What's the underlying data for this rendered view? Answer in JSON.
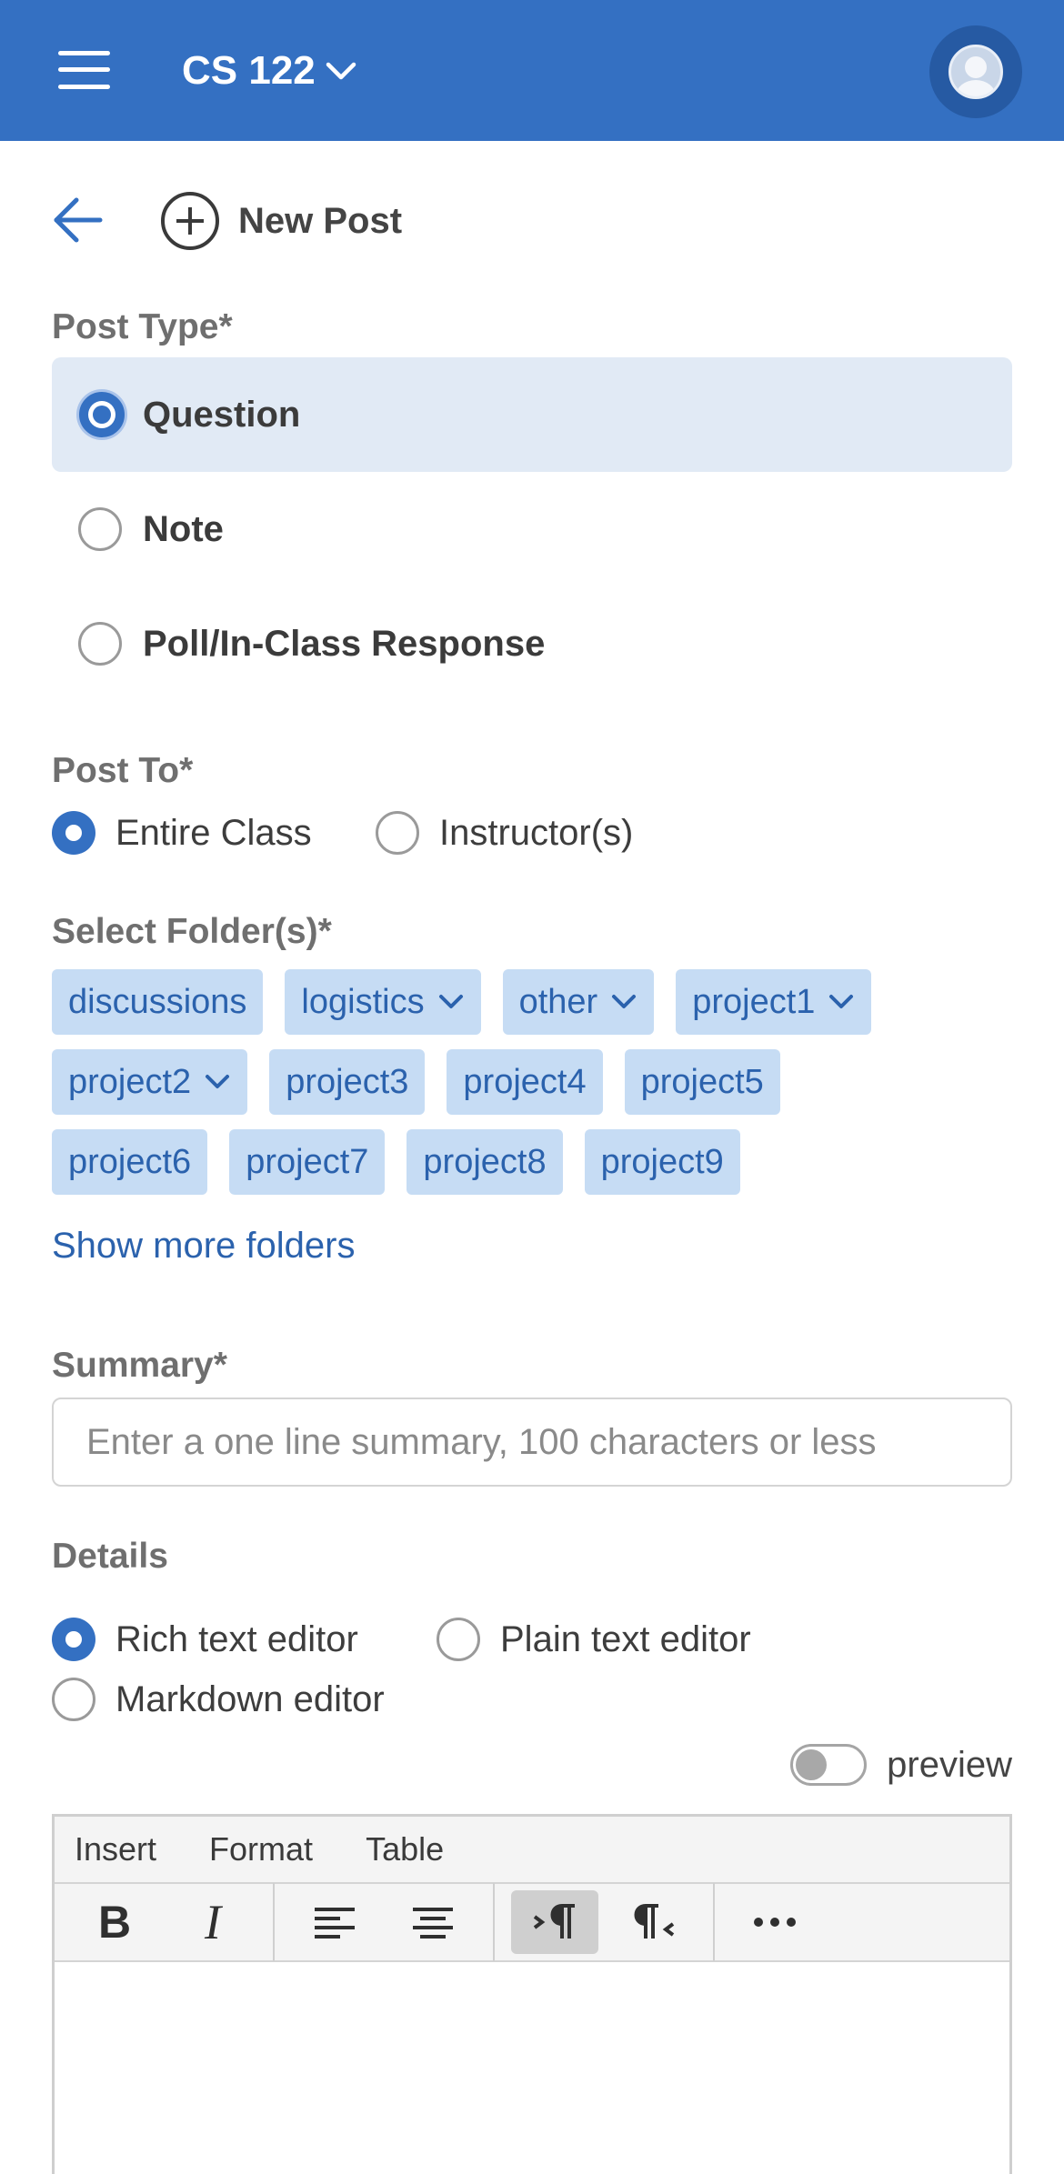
{
  "topbar": {
    "course_name": "CS 122",
    "menu_icon": "hamburger-icon",
    "course_dropdown_icon": "chevron-down-icon",
    "avatar_icon": "user-avatar-icon",
    "color": "#3470c2"
  },
  "header": {
    "back_icon": "arrow-left-icon",
    "new_post_icon": "plus-circle-icon",
    "title": "New Post"
  },
  "post_type": {
    "label": "Post Type*",
    "options": [
      {
        "label": "Question",
        "selected": true
      },
      {
        "label": "Note",
        "selected": false
      },
      {
        "label": "Poll/In-Class Response",
        "selected": false
      }
    ]
  },
  "post_to": {
    "label": "Post To*",
    "options": [
      {
        "label": "Entire Class",
        "selected": true
      },
      {
        "label": "Instructor(s)",
        "selected": false
      }
    ]
  },
  "folders": {
    "label": "Select Folder(s)*",
    "chips": [
      {
        "label": "discussions",
        "has_dropdown": false
      },
      {
        "label": "logistics",
        "has_dropdown": true
      },
      {
        "label": "other",
        "has_dropdown": true
      },
      {
        "label": "project1",
        "has_dropdown": true
      },
      {
        "label": "project2",
        "has_dropdown": true
      },
      {
        "label": "project3",
        "has_dropdown": false
      },
      {
        "label": "project4",
        "has_dropdown": false
      },
      {
        "label": "project5",
        "has_dropdown": false
      },
      {
        "label": "project6",
        "has_dropdown": false
      },
      {
        "label": "project7",
        "has_dropdown": false
      },
      {
        "label": "project8",
        "has_dropdown": false
      },
      {
        "label": "project9",
        "has_dropdown": false
      }
    ],
    "show_more": "Show more folders"
  },
  "summary": {
    "label": "Summary*",
    "placeholder": "Enter a one line summary, 100 characters or less",
    "value": ""
  },
  "details": {
    "label": "Details",
    "editor_options": [
      {
        "label": "Rich text editor",
        "selected": true
      },
      {
        "label": "Plain text editor",
        "selected": false
      },
      {
        "label": "Markdown editor",
        "selected": false
      }
    ],
    "preview_label": "preview",
    "preview_on": false
  },
  "editor": {
    "menu": [
      "Insert",
      "Format",
      "Table"
    ],
    "tools": {
      "bold": "B",
      "italic": "I",
      "bold_icon": "bold-icon",
      "italic_icon": "italic-icon",
      "align_left_icon": "align-left-icon",
      "align_center_icon": "align-center-icon",
      "ltr_icon": "left-to-right-icon",
      "rtl_icon": "right-to-left-icon",
      "more_icon": "more-horizontal-icon"
    }
  }
}
